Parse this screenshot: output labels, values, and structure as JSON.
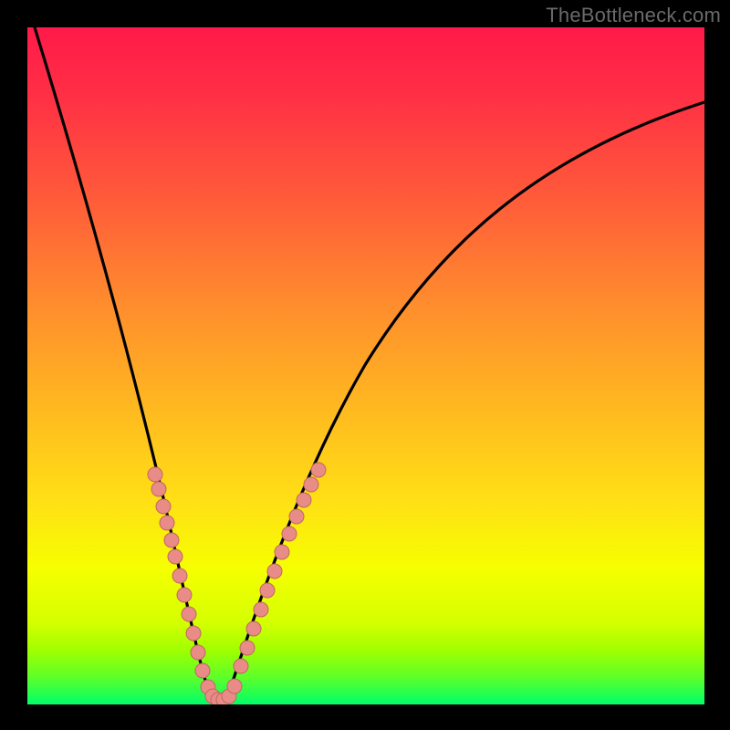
{
  "watermark": {
    "text": "TheBottleneck.com"
  },
  "chart_data": {
    "type": "line",
    "title": "",
    "xlabel": "",
    "ylabel": "",
    "xlim": [
      0,
      100
    ],
    "ylim": [
      0,
      100
    ],
    "grid": false,
    "legend": false,
    "series": [
      {
        "name": "bottleneck-curve",
        "x": [
          0,
          5,
          10,
          15,
          20,
          23,
          25,
          27,
          29,
          30,
          33,
          37,
          42,
          50,
          60,
          70,
          80,
          90,
          100
        ],
        "values": [
          100,
          80,
          60,
          40,
          22,
          10,
          3,
          0,
          1,
          3,
          10,
          22,
          34,
          50,
          62,
          72,
          78,
          82,
          84
        ]
      }
    ],
    "markers": [
      {
        "name": "left-branch-dots",
        "x": [
          16.5,
          17.2,
          18.0,
          18.8,
          19.5,
          20.2,
          21.0,
          21.8,
          22.6,
          23.3,
          24.0,
          24.8
        ],
        "values": [
          36,
          33,
          30,
          27,
          24,
          21,
          18,
          14,
          11,
          8,
          5,
          3
        ]
      },
      {
        "name": "right-branch-dots",
        "x": [
          30.5,
          31.3,
          32.0,
          32.8,
          33.6,
          34.3,
          35.1,
          35.8,
          36.6,
          37.4,
          38.1,
          38.9
        ],
        "values": [
          5,
          8,
          11,
          14,
          17,
          20,
          23,
          26,
          29,
          32,
          34,
          36
        ]
      },
      {
        "name": "bottom-dots",
        "x": [
          25.5,
          26.3,
          27.0,
          27.8,
          28.5,
          29.3
        ],
        "values": [
          1,
          0,
          0,
          0,
          0,
          1
        ]
      }
    ],
    "colors": {
      "curve": "#000000",
      "marker_fill": "#e98b86",
      "marker_stroke": "#c06860"
    }
  }
}
